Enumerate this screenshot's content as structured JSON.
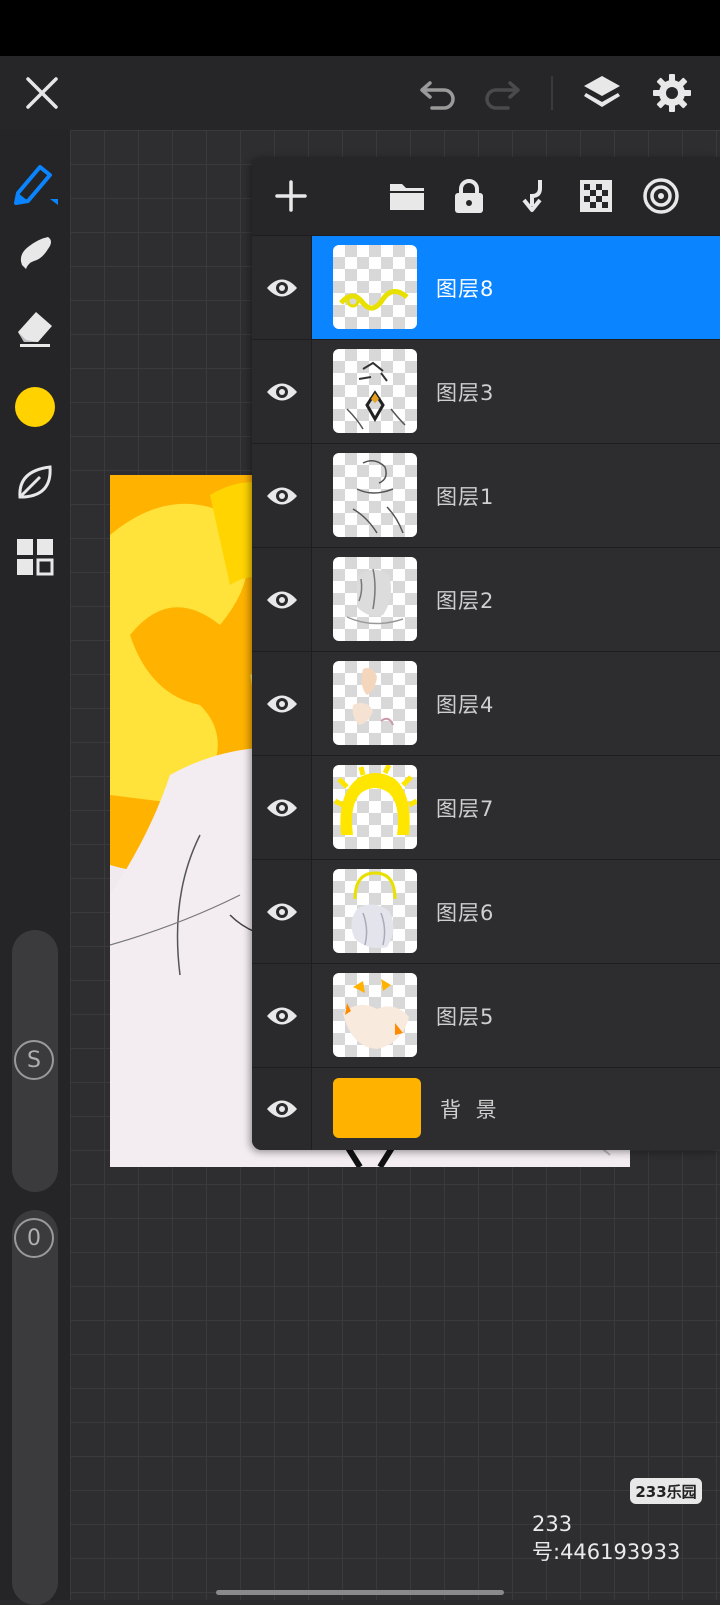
{
  "colors": {
    "accent": "#0a84ff",
    "current_color": "#ffd200",
    "background_layer": "#ffb300"
  },
  "topbar": {
    "icons": [
      "close-icon",
      "undo-icon",
      "redo-icon",
      "layers-icon",
      "settings-icon"
    ]
  },
  "left_toolbar": {
    "tools": [
      "brush-icon",
      "smudge-icon",
      "eraser-icon",
      "color-swatch",
      "leaf-icon",
      "gallery-icon"
    ],
    "size_slider_label": "S",
    "opacity_slider_label": "0"
  },
  "layers_panel": {
    "toolbar_icons": [
      "add-icon",
      "folder-icon",
      "lock-icon",
      "merge-down-icon",
      "transparency-icon",
      "blend-icon"
    ],
    "layers": [
      {
        "name": "图层8",
        "selected": true
      },
      {
        "name": "图层3",
        "selected": false
      },
      {
        "name": "图层1",
        "selected": false
      },
      {
        "name": "图层2",
        "selected": false
      },
      {
        "name": "图层4",
        "selected": false
      },
      {
        "name": "图层7",
        "selected": false
      },
      {
        "name": "图层6",
        "selected": false
      },
      {
        "name": "图层5",
        "selected": false
      }
    ],
    "background_layer_name": "背 景"
  },
  "watermark": {
    "logo": "233乐园",
    "text": "233号:446193933"
  }
}
